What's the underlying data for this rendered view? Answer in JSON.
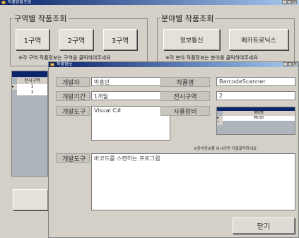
{
  "main_window": {
    "title": "작품현황조회",
    "left_group": {
      "title": "구역별 작품조회",
      "buttons": [
        "1구역",
        "2구역",
        "3구역"
      ],
      "hint": "※각 구역 작품정보는 구역을 클릭하여주세요"
    },
    "right_group": {
      "title": "분야별 작품조회",
      "buttons": [
        "정보통신",
        "메카트로닉스"
      ],
      "hint": "※각 분야 작품정보는 분야를 클릭하여주세요"
    },
    "bg_grid": {
      "header": "전시구역",
      "rows": [
        "1",
        "1"
      ]
    }
  },
  "detail_window": {
    "title": "작품정보",
    "labels": {
      "developer": "개발자",
      "period": "개발기간",
      "tool": "개발도구",
      "name": "작품명",
      "zone": "전시구역",
      "equipment": "사용장비",
      "description": "개발도구"
    },
    "values": {
      "developer": "박홍민",
      "period": "1개월",
      "tool": "Visual C#",
      "name": "BarcodeScanner",
      "zone": "2",
      "description": "바코드를 스캔하는 프로그램"
    },
    "equipment_grid": {
      "header": "장비명",
      "rows": [
        "MC50"
      ]
    },
    "equipment_hint": "※장비정보를 보시려면 더블클릭하세요",
    "close_button": "닫기"
  },
  "colors": {
    "titlebar_start": "#0a246a",
    "titlebar_end": "#a6caf0",
    "window_bg": "#d4d0c8"
  }
}
